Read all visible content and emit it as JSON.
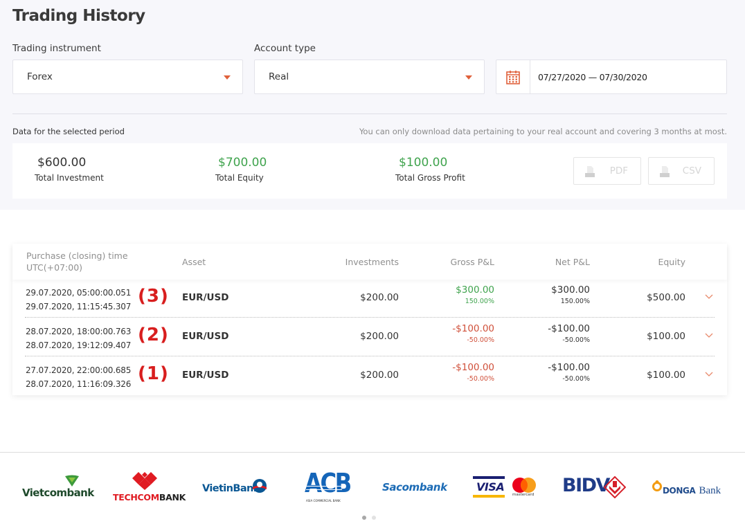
{
  "page": {
    "title": "Trading History"
  },
  "filters": {
    "instrument": {
      "label": "Trading instrument",
      "value": "Forex"
    },
    "account": {
      "label": "Account type",
      "value": "Real"
    },
    "date_range": {
      "value": "07/27/2020 — 07/30/2020",
      "icon": "calendar-icon"
    }
  },
  "summary": {
    "period_label": "Data for the selected period",
    "download_note": "You can only download data pertaining to your real account and covering 3 months at most.",
    "stats": [
      {
        "value": "$600.00",
        "label": "Total Investment"
      },
      {
        "value": "$700.00",
        "label": "Total Equity"
      },
      {
        "value": "$100.00",
        "label": "Total Gross Profit"
      }
    ],
    "downloads": [
      {
        "label": "PDF",
        "icon": "file-download-icon"
      },
      {
        "label": "CSV",
        "icon": "file-download-icon"
      }
    ]
  },
  "table": {
    "headers": {
      "time_line1": "Purchase (closing) time",
      "time_line2": "UTC(+07:00)",
      "asset": "Asset",
      "investments": "Investments",
      "gross": "Gross P&L",
      "net": "Net P&L",
      "equity": "Equity"
    },
    "rows": [
      {
        "open_time": "29.07.2020, 05:00:00.051",
        "close_time": "29.07.2020, 11:15:45.307",
        "annotation": "(3)",
        "asset": "EUR/USD",
        "investment": "$200.00",
        "gross_amount": "$300.00",
        "gross_pct": "150.00%",
        "net_amount": "$300.00",
        "net_pct": "150.00%",
        "equity": "$500.00",
        "direction": "positive"
      },
      {
        "open_time": "28.07.2020, 18:00:00.763",
        "close_time": "28.07.2020, 19:12:09.407",
        "annotation": "(2)",
        "asset": "EUR/USD",
        "investment": "$200.00",
        "gross_amount": "-$100.00",
        "gross_pct": "-50.00%",
        "net_amount": "-$100.00",
        "net_pct": "-50.00%",
        "equity": "$100.00",
        "direction": "negative"
      },
      {
        "open_time": "27.07.2020, 22:00:00.685",
        "close_time": "28.07.2020, 11:16:09.326",
        "annotation": "(1)",
        "asset": "EUR/USD",
        "investment": "$200.00",
        "gross_amount": "-$100.00",
        "gross_pct": "-50.00%",
        "net_amount": "-$100.00",
        "net_pct": "-50.00%",
        "equity": "$100.00",
        "direction": "negative"
      }
    ]
  },
  "partners": {
    "logos": [
      {
        "name": "Vietcombank"
      },
      {
        "name": "TECHCOMBANK",
        "part1": "TECHCOM",
        "part2": "BANK"
      },
      {
        "name": "VietinBank"
      },
      {
        "name": "ACB",
        "subtitle": "ASIA COMMERCIAL BANK"
      },
      {
        "name": "Sacombank"
      },
      {
        "name": "VISA",
        "secondary": "mastercard"
      },
      {
        "name": "BIDV"
      },
      {
        "name": "DONGA Bank",
        "part1": "DONGA",
        "part2": "Bank"
      }
    ],
    "carousel": {
      "pages": 2,
      "active": 1
    }
  },
  "colors": {
    "accent": "#e0613b",
    "positive": "#3fa34d",
    "negative": "#d0503a",
    "annotation": "#d81e1e"
  }
}
